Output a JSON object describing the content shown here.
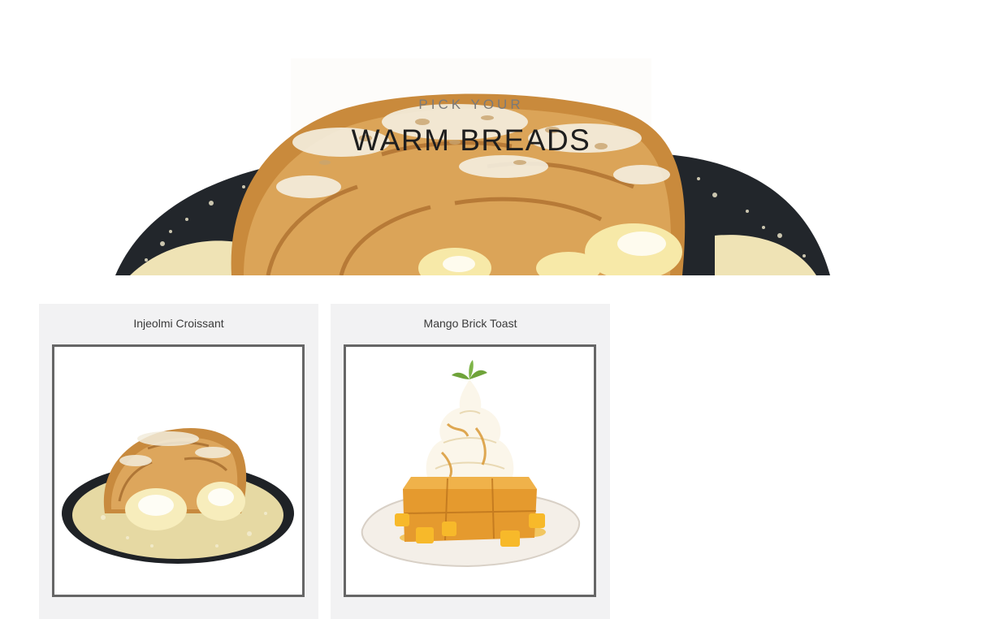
{
  "hero": {
    "kicker": "PICK YOUR",
    "title": "WARM BREADS"
  },
  "products": [
    {
      "name": "Injeolmi Croissant",
      "image": "injeolmi-croissant-photo"
    },
    {
      "name": "Mango Brick Toast",
      "image": "mango-brick-toast-photo"
    }
  ]
}
